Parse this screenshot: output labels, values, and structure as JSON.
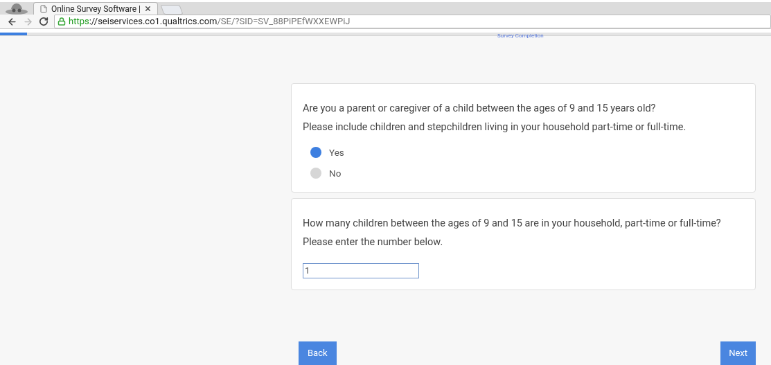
{
  "browser": {
    "tab": {
      "title": "Online Survey Software |",
      "selected": true
    },
    "url": {
      "scheme": "https",
      "host": "://seiservices.co1.qualtrics.com",
      "path": "/SE/?SID=SV_88PiPEfWXXEWPiJ"
    }
  },
  "progress": {
    "label": "Survey Completion",
    "level": 0.035
  },
  "questions": [
    {
      "kind": "choice",
      "text": "Are you a parent or caregiver of a child between the ages of 9 and 15 years old?\nPlease include children and stepchildren living in your household part-time or full-time.",
      "options": [
        {
          "label": "Yes",
          "selected": true
        },
        {
          "label": "No",
          "selected": false
        }
      ]
    },
    {
      "kind": "text_entry",
      "text": "How many children between the ages of 9 and 15 are in your household, part-time or full-time?  Please enter the number below.",
      "value": "1"
    }
  ],
  "buttons": {
    "back": "Back",
    "next": "Next"
  }
}
